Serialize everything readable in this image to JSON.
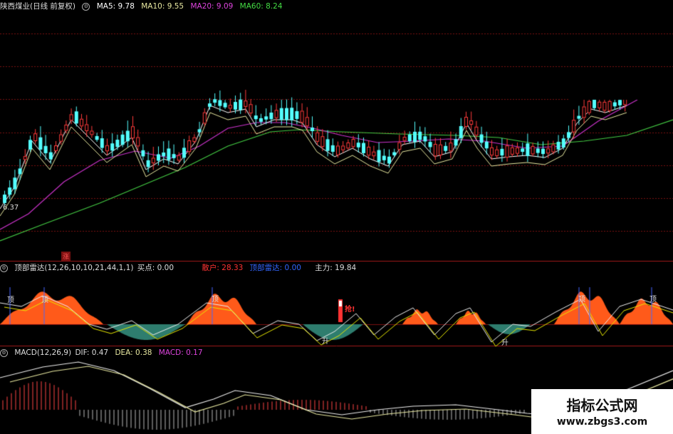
{
  "main_header": {
    "title": "陕西煤业(日线 前复权)",
    "ma5": "MA5: 9.78",
    "ma10": "MA10: 9.55",
    "ma20": "MA20: 9.09",
    "ma60": "MA60: 8.24"
  },
  "low_price_label": "6.37",
  "indicator_header": {
    "name": "顶部雷达(12,26,10,10,21,44,1,1)",
    "buy_point": "买点: 0.00",
    "retail": "散户: 28.33",
    "top_radar": "顶部雷达: 0.00",
    "main_force": "主力: 19.84"
  },
  "indicator_labels": {
    "top": "顶",
    "rise": "升",
    "grab": "抢!",
    "up_marker": "涨"
  },
  "macd_header": {
    "name": "MACD(12,26,9)",
    "dif": "DIF: 0.47",
    "dea": "DEA: 0.38",
    "macd": "MACD: 0.17"
  },
  "watermark": {
    "title": "指标公式网",
    "url": "www.zbgs3.com"
  },
  "colors": {
    "up": "#ff3b3b",
    "down": "#54ffff",
    "ma5": "#ffffff",
    "ma10": "#e8e8a0",
    "ma20": "#cc33cc",
    "ma60": "#44cc44",
    "grid": "#7a1010",
    "radar_fill": "#ff5a1a",
    "low_fill": "#2e7d6e"
  }
}
